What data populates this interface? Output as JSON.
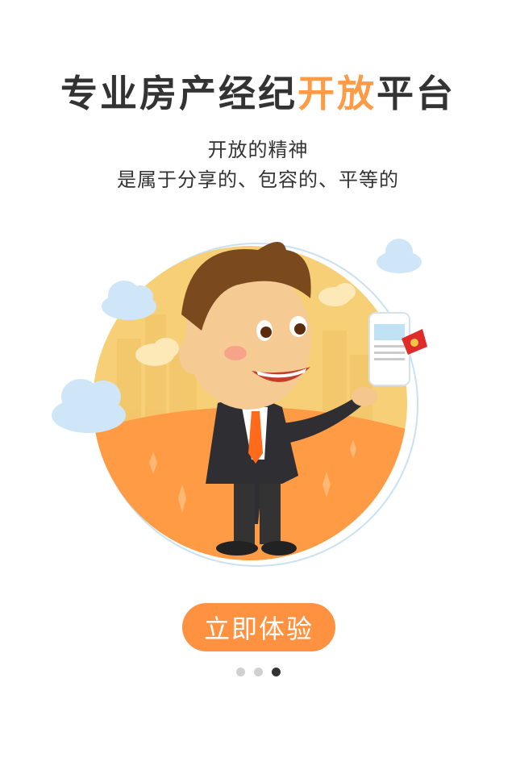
{
  "colors": {
    "accent": "#ff9b44",
    "button_bg": "#ff9240",
    "dot_inactive": "#d0d0d0",
    "dot_active": "#333333"
  },
  "header": {
    "title_prefix": "专业房产经纪",
    "title_highlight": "开放",
    "title_suffix": "平台",
    "subtitle_line1": "开放的精神",
    "subtitle_line2": "是属于分享的、包容的、平等的"
  },
  "illustration": {
    "icon": "agent-with-phone-illustration"
  },
  "cta": {
    "label": "立即体验"
  },
  "pagination": {
    "total": 3,
    "active_index": 2
  }
}
